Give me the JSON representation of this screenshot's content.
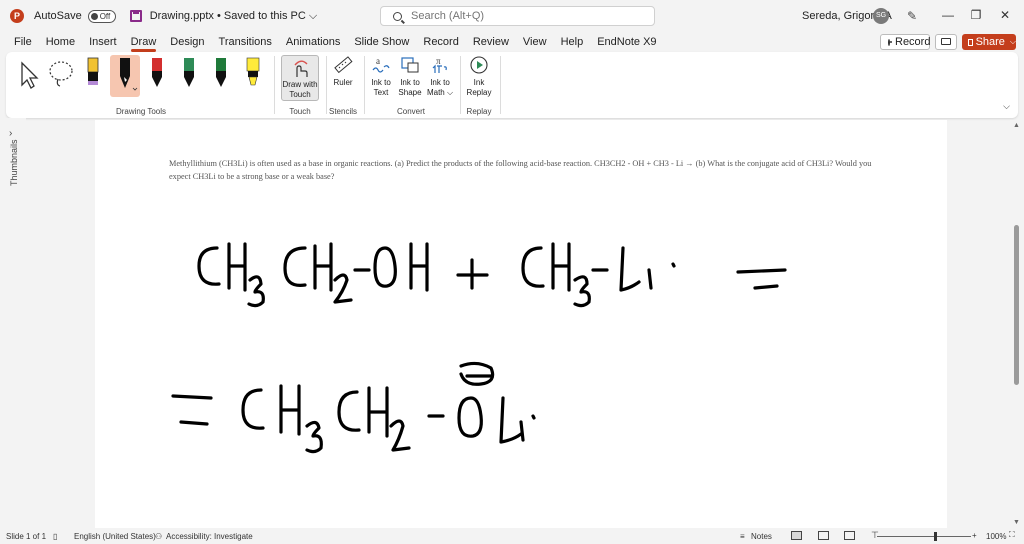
{
  "titlebar": {
    "app_logo": "P",
    "autosave_label": "AutoSave",
    "autosave_state": "Off",
    "document_title": "Drawing.pptx • Saved to this PC ⌵",
    "search_placeholder": "Search (Alt+Q)",
    "user_name": "Sereda, Grigoriy A",
    "user_initials": "SG",
    "minimize": "—",
    "maximize": "❐",
    "close": "✕"
  },
  "menu": {
    "tabs": [
      "File",
      "Home",
      "Insert",
      "Draw",
      "Design",
      "Transitions",
      "Animations",
      "Slide Show",
      "Record",
      "Review",
      "View",
      "Help",
      "EndNote X9"
    ],
    "active_tab": "Draw",
    "record_label": "Record",
    "share_label": "Share",
    "share_chevron": "⌵"
  },
  "ribbon": {
    "groups": {
      "drawing_tools": "Drawing Tools",
      "touch": "Touch",
      "stencils": "Stencils",
      "convert": "Convert",
      "replay": "Replay"
    },
    "buttons": {
      "draw_with_touch_line1": "Draw with",
      "draw_with_touch_line2": "Touch",
      "ruler": "Ruler",
      "ink_to_text_line1": "Ink to",
      "ink_to_text_line2": "Text",
      "ink_to_shape_line1": "Ink to",
      "ink_to_shape_line2": "Shape",
      "ink_to_math_line1": "Ink to",
      "ink_to_math_line2": "Math ⌵",
      "ink_replay_line1": "Ink",
      "ink_replay_line2": "Replay"
    },
    "pen_colors": {
      "yellow_purple": "#f1c232",
      "black": "#111111",
      "red": "#d32f2f",
      "green": "#2e8b57",
      "green2": "#1f7a3a",
      "highlighter": "#ffeb3b"
    }
  },
  "sidebar": {
    "thumbnails_label": "Thumbnails",
    "expand_chevron": "›"
  },
  "slide": {
    "question_text": "Methyllithium (CH3Li) is often used as a base in organic reactions. (a) Predict the products of the following acid-base reaction. CH3CH2 - OH + CH3 - Li → (b) What is the conjugate acid of CH3Li? Would you expect CH3Li to be a strong base or a weak base?"
  },
  "statusbar": {
    "slide_info": "Slide 1 of 1",
    "language": "English (United States)",
    "accessibility": "Accessibility: Investigate",
    "notes": "Notes",
    "zoom": "100%",
    "zoom_minus": "−",
    "zoom_plus": "+"
  }
}
